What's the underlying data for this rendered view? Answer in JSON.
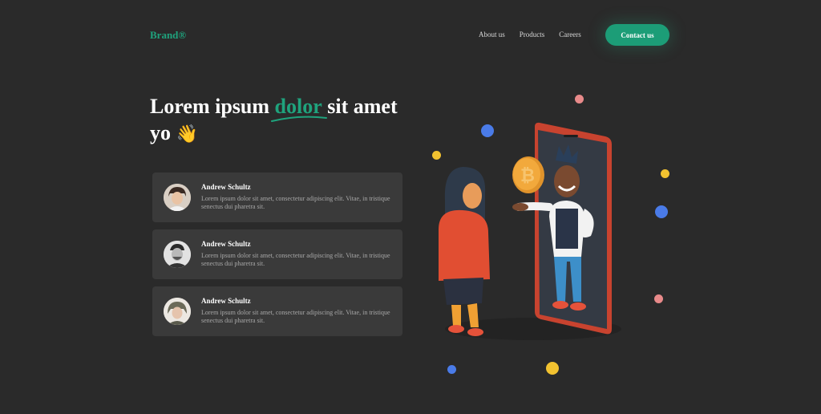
{
  "nav": {
    "brand": "Brand®",
    "links": [
      "About us",
      "Products",
      "Careers"
    ],
    "cta": "Contact us"
  },
  "hero": {
    "title_part1": "Lorem ipsum ",
    "title_accent": "dolor",
    "title_part2": " sit amet",
    "title_line2": "yo",
    "emoji": "👋"
  },
  "testimonials": [
    {
      "name": "Andrew Schultz",
      "text": "Lorem ipsum dolor sit amet, consectetur adipiscing elit. Vitae, in tristique senectus dui pharetra sit."
    },
    {
      "name": "Andrew Schultz",
      "text": "Lorem ipsum dolor sit amet, consectetur adipiscing elit. Vitae, in tristique senectus dui pharetra sit."
    },
    {
      "name": "Andrew Schultz",
      "text": "Lorem ipsum dolor sit amet, consectetur adipiscing elit. Vitae, in tristique senectus dui pharetra sit."
    }
  ],
  "colors": {
    "background": "#2a2a2a",
    "accent": "#1fa37d",
    "card": "#3a3a3a"
  }
}
